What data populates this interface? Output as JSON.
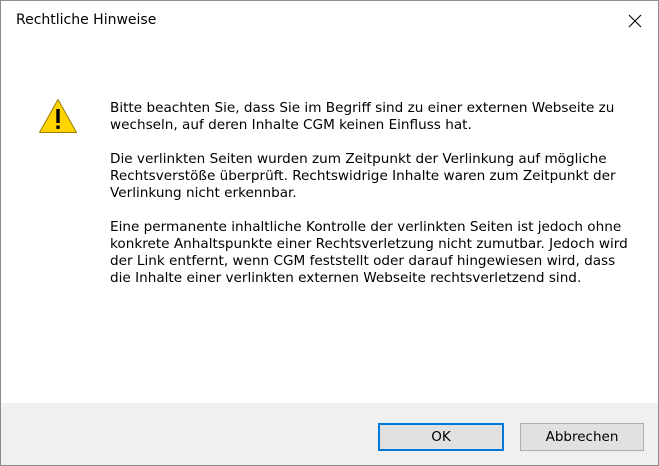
{
  "window": {
    "title": "Rechtliche Hinweise",
    "close_glyph": "×"
  },
  "icon": {
    "name": "warning-icon",
    "fill_color": "#FFD400",
    "stroke_color": "#9A7B00",
    "mark_color": "#000000",
    "mark": "!"
  },
  "message": {
    "paragraph_1": "Bitte beachten Sie, dass Sie im Begriff sind zu einer externen Webseite zu wechseln, auf deren Inhalte CGM keinen Einfluss hat.",
    "paragraph_2": "Die verlinkten Seiten wurden zum Zeitpunkt der Verlinkung auf mögliche Rechtsverstöße überprüft. Rechtswidrige Inhalte waren zum Zeitpunkt der Verlinkung nicht erkennbar.",
    "paragraph_3": "Eine permanente inhaltliche Kontrolle der verlinkten Seiten ist jedoch ohne konkrete Anhaltspunkte einer Rechtsverletzung nicht zumutbar. Jedoch wird der Link entfernt, wenn CGM feststellt oder darauf hingewiesen wird, dass die Inhalte einer verlinkten externen Webseite rechtsverletzend sind."
  },
  "buttons": {
    "ok_label": "OK",
    "cancel_label": "Abbrechen",
    "default_accent": "#0078D7"
  }
}
